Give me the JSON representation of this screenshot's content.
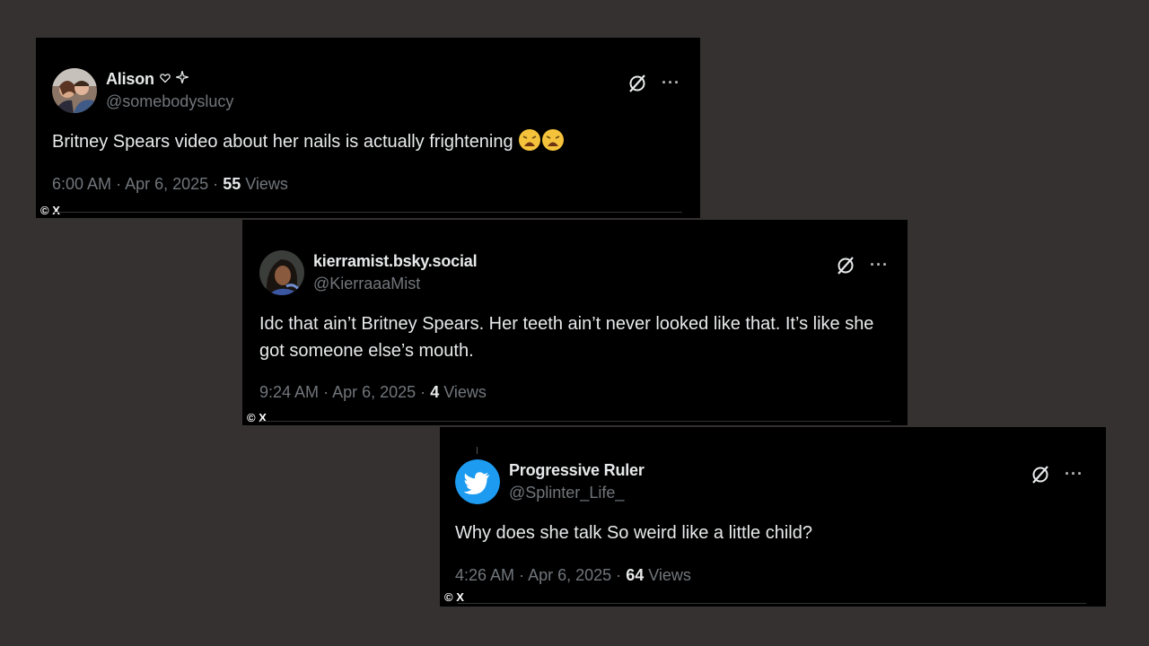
{
  "tweets": [
    {
      "display_name": "Alison",
      "handle": "@somebodyslucy",
      "text": "Britney Spears video about her nails is actually frightening",
      "time": "6:00 AM",
      "separator": "·",
      "date": "Apr 6, 2025",
      "views_count": "55",
      "views_label": "Views",
      "copyright": "© X"
    },
    {
      "display_name": "kierramist.bsky.social",
      "handle": "@KierraaaMist",
      "text": "Idc that ain’t Britney Spears. Her teeth ain’t never looked like that. It’s like she got someone else’s mouth.",
      "time": "9:24 AM",
      "separator": "·",
      "date": "Apr 6, 2025",
      "views_count": "4",
      "views_label": "Views",
      "copyright": "© X"
    },
    {
      "display_name": "Progressive Ruler",
      "handle": "@Splinter_Life_",
      "text": "Why does she talk So weird like a little child?",
      "time": "4:26 AM",
      "separator": "·",
      "date": "Apr 6, 2025",
      "views_count": "64",
      "views_label": "Views",
      "copyright": "© X"
    }
  ],
  "more_label": "···",
  "colors": {
    "background": "#353131",
    "card": "#000000",
    "text_primary": "#e7e9ea",
    "text_secondary": "#71767b",
    "twitter_blue": "#1d9bf0"
  },
  "icons": [
    "grok-icon",
    "more-options-icon",
    "heart-outline-icon",
    "sparkle-icon",
    "weary-face-emoji",
    "twitter-bird-icon"
  ]
}
